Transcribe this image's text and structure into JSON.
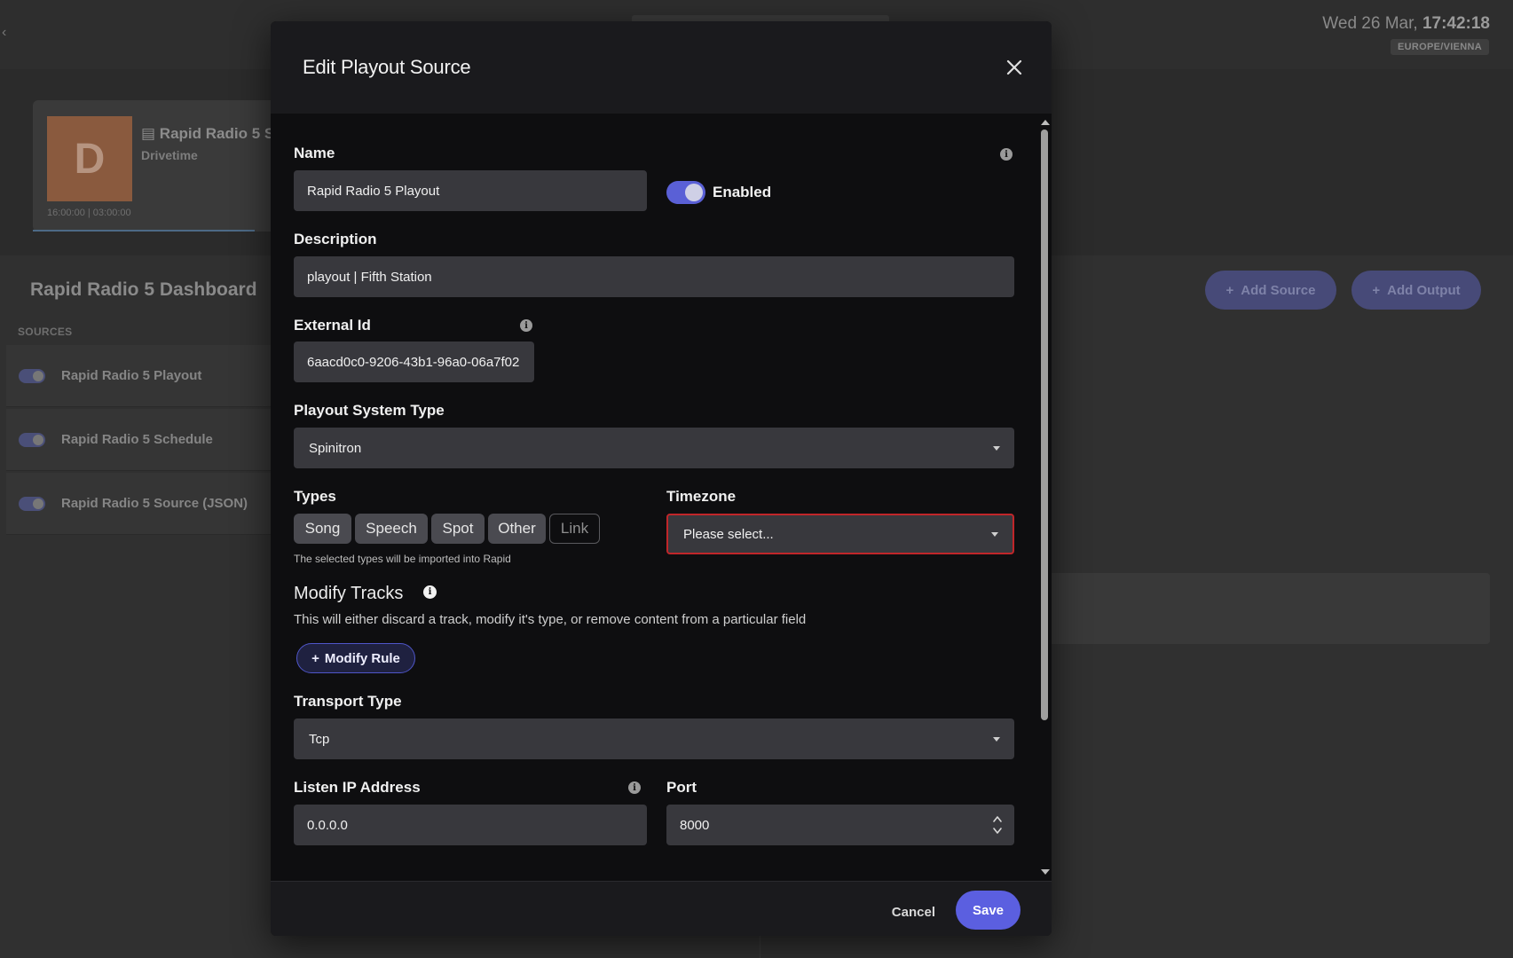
{
  "clock": {
    "date": "Wed 26 Mar,",
    "time": "17:42:18",
    "timezone": "EUROPE/VIENNA"
  },
  "show": {
    "initial": "D",
    "title": "Rapid Radio 5 S",
    "subtitle": "Drivetime",
    "time": "16:00:00  |  03:00:00"
  },
  "dashboard": {
    "title": "Rapid Radio 5 Dashboard",
    "sources_label": "SOURCES",
    "sources": [
      {
        "label": "Rapid Radio 5 Playout"
      },
      {
        "label": "Rapid Radio 5 Schedule"
      },
      {
        "label": "Rapid Radio 5 Source (JSON)"
      }
    ],
    "add_source": "Add Source",
    "add_output": "Add Output"
  },
  "modal": {
    "title": "Edit Playout Source",
    "name_label": "Name",
    "name_value": "Rapid Radio 5 Playout",
    "enabled_label": "Enabled",
    "description_label": "Description",
    "description_value": "playout | Fifth Station",
    "external_id_label": "External Id",
    "external_id_value": "6aacd0c0-9206-43b1-96a0-06a7f02",
    "playout_system_label": "Playout System Type",
    "playout_system_value": "Spinitron",
    "types_label": "Types",
    "types": [
      "Song",
      "Speech",
      "Spot",
      "Other",
      "Link"
    ],
    "types_hint": "The selected types will be imported into Rapid",
    "timezone_label": "Timezone",
    "timezone_value": "Please select...",
    "modify_tracks_title": "Modify Tracks",
    "modify_tracks_desc": "This will either discard a track, modify it's type, or remove content from a particular field",
    "modify_rule_label": "Modify Rule",
    "transport_label": "Transport Type",
    "transport_value": "Tcp",
    "listen_ip_label": "Listen IP Address",
    "listen_ip_value": "0.0.0.0",
    "port_label": "Port",
    "port_value": "8000",
    "cancel_label": "Cancel",
    "save_label": "Save"
  },
  "colors": {
    "accent": "#5b5fe0",
    "error": "#c0262a",
    "modal_bg": "#0e0e10",
    "field_bg": "#38383d"
  }
}
